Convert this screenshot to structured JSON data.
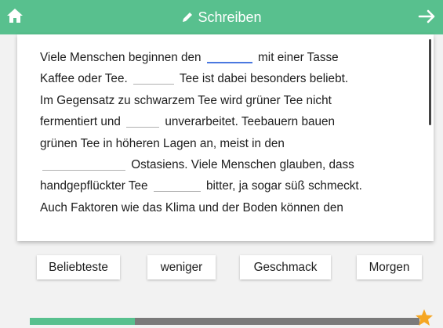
{
  "header": {
    "title": "Schreiben",
    "home_icon": "home-icon",
    "title_icon": "pencil-icon",
    "next_icon": "arrow-right-icon"
  },
  "text_lines": [
    {
      "segments": [
        {
          "t": "Viele Menschen beginnen den "
        },
        {
          "gap": true,
          "active": true,
          "w": 58
        },
        {
          "t": " mit einer Tasse"
        }
      ]
    },
    {
      "segments": [
        {
          "t": "Kaffee oder Tee. "
        },
        {
          "gap": true,
          "w": 52
        },
        {
          "t": " Tee ist dabei besonders beliebt."
        }
      ]
    },
    {
      "segments": [
        {
          "t": "Im Gegensatz zu schwarzem Tee wird grüner Tee nicht"
        }
      ]
    },
    {
      "segments": [
        {
          "t": "fermentiert und "
        },
        {
          "gap": true,
          "w": 42
        },
        {
          "t": " unverarbeitet. Teebauern bauen"
        }
      ]
    },
    {
      "segments": [
        {
          "t": "grünen Tee in höheren Lagen an, meist in den"
        }
      ]
    },
    {
      "segments": [
        {
          "gap": true,
          "w": 106
        },
        {
          "t": " Ostasiens. Viele Menschen glauben, dass"
        }
      ]
    },
    {
      "segments": [
        {
          "t": "handgepflückter Tee "
        },
        {
          "gap": true,
          "w": 60
        },
        {
          "t": " bitter, ja sogar süß schmeckt."
        }
      ]
    },
    {
      "segments": [
        {
          "t": "Auch Faktoren wie das Klima und der Boden können den"
        }
      ]
    }
  ],
  "options": [
    "Beliebteste",
    "weniger",
    "Geschmack",
    "Morgen"
  ],
  "progress": {
    "value": 0.27,
    "star_icon": "star-icon"
  },
  "colors": {
    "accent": "#58c08e",
    "active_gap": "#4a78e0",
    "track": "#7a7a7a",
    "star": "#f5a623"
  }
}
